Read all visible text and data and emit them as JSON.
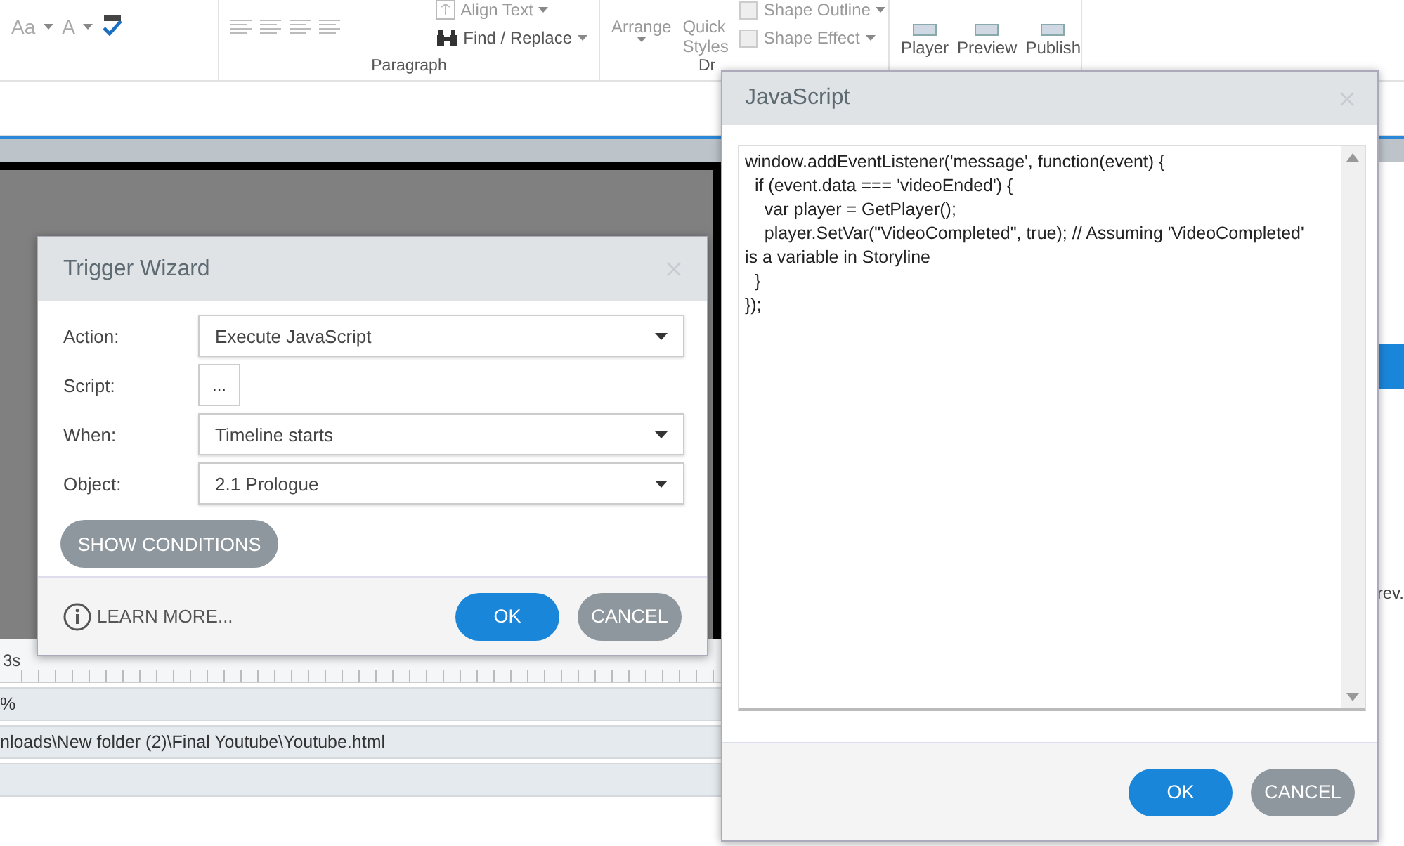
{
  "ribbon": {
    "font_items": [
      {
        "label": "Aa"
      },
      {
        "label": "A"
      }
    ],
    "paragraph": {
      "label": "Paragraph",
      "items": [
        "Align Text",
        "Find / Replace"
      ]
    },
    "drawing": {
      "label": "Dr",
      "arrange": "Arrange",
      "quick_styles": [
        "Quick",
        "Styles"
      ],
      "shape_items": [
        "Shape Outline",
        "Shape Effect"
      ]
    },
    "publish_items": [
      "Player",
      "Preview",
      "Publish"
    ]
  },
  "timeline": {
    "time_label": "3s"
  },
  "status_rows": [
    "%",
    "nloads\\New folder (2)\\Final Youtube\\Youtube.html"
  ],
  "side_panel": {
    "label": "rev."
  },
  "trigger_wizard": {
    "title": "Trigger Wizard",
    "fields": [
      {
        "label": "Action:",
        "kind": "dropdown",
        "value": "Execute JavaScript"
      },
      {
        "label": "Script:",
        "kind": "button",
        "value": "..."
      },
      {
        "label": "When:",
        "kind": "dropdown",
        "value": "Timeline starts"
      },
      {
        "label": "Object:",
        "kind": "dropdown",
        "value": "2.1 Prologue"
      }
    ],
    "show_conditions": "SHOW CONDITIONS",
    "learn_more": "LEARN MORE...",
    "ok": "OK",
    "cancel": "CANCEL"
  },
  "javascript_dialog": {
    "title": "JavaScript",
    "script": "window.addEventListener('message', function(event) {\n  if (event.data === 'videoEnded') {\n    var player = GetPlayer();\n    player.SetVar(\"VideoCompleted\", true); // Assuming 'VideoCompleted' is a variable in Storyline\n  }\n});",
    "ok": "OK",
    "cancel": "CANCEL"
  }
}
